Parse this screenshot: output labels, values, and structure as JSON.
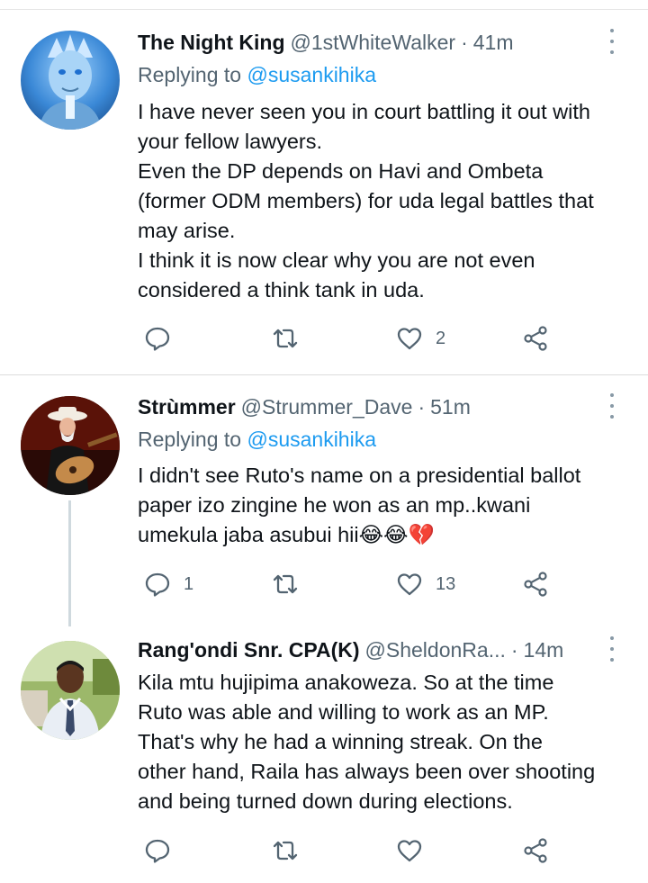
{
  "tweets": [
    {
      "name": "The Night King",
      "handle": "@1stWhiteWalker",
      "dot": "·",
      "time": "41m",
      "replying_prefix": "Replying to",
      "replying_to": "@susankihika",
      "lines": [
        "I have never seen you in court battling it out with",
        "your fellow lawyers.",
        "Even the DP depends on Havi and Ombeta",
        "(former ODM members) for uda legal battles that",
        "may arise.",
        "I think it is now clear why you are not even",
        "considered a think tank in uda."
      ],
      "reply_count": "",
      "retweet_count": "",
      "like_count": "2"
    },
    {
      "name": "Strùmmer",
      "handle": "@Strummer_Dave",
      "dot": "·",
      "time": "51m",
      "replying_prefix": "Replying to",
      "replying_to": "@susankihika",
      "lines": [
        "I didn't see Ruto's name on a presidential ballot",
        "paper izo zingine he won as an mp..kwani",
        "umekula jaba asubui hii😂😂💔"
      ],
      "reply_count": "1",
      "retweet_count": "",
      "like_count": "13"
    },
    {
      "name": "Rang'ondi Snr. CPA(K)",
      "handle": "@SheldonRa...",
      "dot": "·",
      "time": "14m",
      "lines": [
        "Kila mtu hujipima anakoweza. So at the time",
        "Ruto was able and willing to work as an MP.",
        "That's  why he had a winning streak. On the",
        "other hand, Raila has always been over shooting",
        "and being turned down during elections."
      ],
      "reply_count": "",
      "retweet_count": "",
      "like_count": ""
    }
  ],
  "icons": {
    "reply": "reply-icon",
    "retweet": "retweet-icon",
    "like": "heart-icon",
    "share": "share-icon",
    "more": "more-icon"
  },
  "colors": {
    "text": "#0f1419",
    "secondary": "#536471",
    "link": "#1d9bf0",
    "divider": "#dcdcdc",
    "thread_line": "#cfd9de"
  }
}
